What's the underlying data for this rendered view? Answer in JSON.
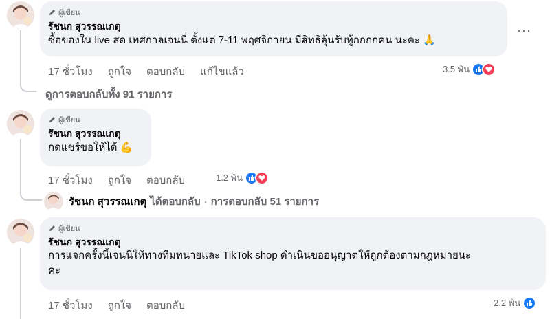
{
  "comments": [
    {
      "badge": "ผู้เขียน",
      "author": "รัชนก สุวรรณเกตุ",
      "text": "ซื้อของใน live สด เทศกาลเจนนี่ ตั้งแต่ 7-11 พฤศจิกายน มีสิทธิลุ้นรับทู้กกกกคน นะคะ",
      "emoji": "🙏",
      "time": "17 ชั่วโมง",
      "like": "ถูกใจ",
      "reply": "ตอบกลับ",
      "edited": "แก้ไขแล้ว",
      "reactions": "3.5 พัน",
      "more": "···"
    },
    {
      "badge": "ผู้เขียน",
      "author": "รัชนก สุวรรณเกตุ",
      "text": "กดแชร์ขอให้ได้",
      "emoji": "💪",
      "time": "17 ชั่วโมง",
      "like": "ถูกใจ",
      "reply": "ตอบกลับ",
      "reactions": "1.2 พัน"
    },
    {
      "badge": "ผู้เขียน",
      "author": "รัชนก สุวรรณเกตุ",
      "text_line1": "การแจกครั้งนี้เจนนี่ให้ทางทีมทนายและ TikTok shop ดำเนินขออนุญาตให้ถูกต้องตามกฎหมายนะ",
      "text_line2": "คะ",
      "time": "17 ชั่วโมง",
      "like": "ถูกใจ",
      "reply": "ตอบกลับ",
      "reactions": "2.2 พัน"
    }
  ],
  "view_replies": "ดูการตอบกลับทั้ง 91 รายการ",
  "reply_summary": {
    "name": "รัชนก สุวรรณเกตุ",
    "action": "ได้ตอบกลับ",
    "dot": "·",
    "count": "การตอบกลับ 51 รายการ"
  },
  "colors": {
    "like": "#1877f2",
    "love": "#f33e58",
    "bubble": "#f0f2f5",
    "meta": "#65676b"
  },
  "icons": {
    "badge": "pencil-icon",
    "like": "thumbs-up-icon",
    "love": "heart-icon",
    "more": "more-options-icon"
  }
}
